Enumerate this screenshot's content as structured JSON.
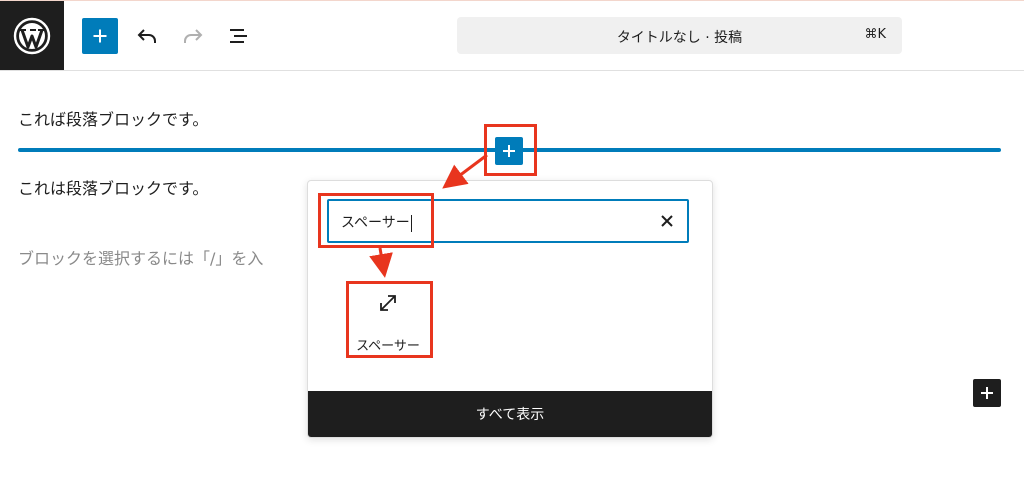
{
  "toolbar": {
    "logo_icon": "wordpress-icon",
    "add_icon": "plus-icon",
    "undo_icon": "undo-icon",
    "redo_icon": "redo-icon",
    "list_view_icon": "list-view-icon"
  },
  "command_bar": {
    "title": "タイトルなし · 投稿",
    "shortcut": "⌘K"
  },
  "editor": {
    "paragraph1": "これば段落ブロックです。",
    "paragraph2": "これは段落ブロックです。",
    "placeholder": "ブロックを選択するには「/」を入"
  },
  "inserter": {
    "search_value": "スペーサー",
    "clear_icon": "close-icon",
    "results": [
      {
        "label": "スペーサー",
        "icon": "resize-arrows-icon"
      }
    ],
    "show_all_label": "すべて表示"
  },
  "colors": {
    "accent": "#007cba",
    "dark": "#1e1e1e",
    "annotation": "#e8351e"
  }
}
